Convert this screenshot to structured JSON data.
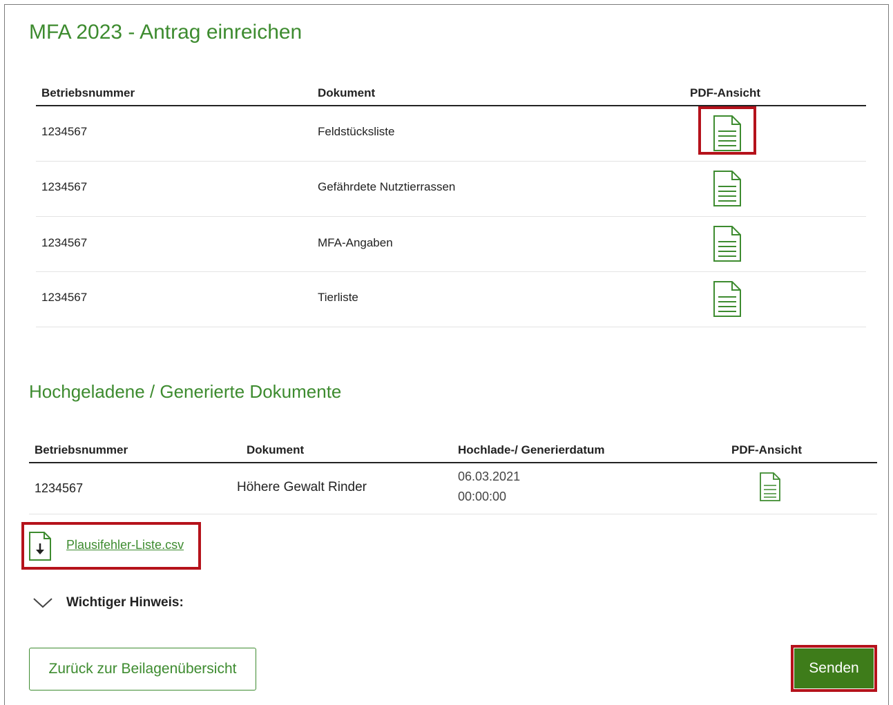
{
  "page": {
    "title": "MFA 2023 - Antrag einreichen"
  },
  "antrag_table": {
    "headers": [
      "Betriebsnummer",
      "Dokument",
      "PDF-Ansicht"
    ],
    "rows": [
      {
        "betriebsnummer": "1234567",
        "dokument": "Feldstücksliste",
        "icon": "pdf-document-icon"
      },
      {
        "betriebsnummer": "1234567",
        "dokument": "Gefährdete Nutztierrassen",
        "icon": "pdf-document-icon"
      },
      {
        "betriebsnummer": "1234567",
        "dokument": "MFA-Angaben",
        "icon": "pdf-document-icon"
      },
      {
        "betriebsnummer": "1234567",
        "dokument": "Tierliste",
        "icon": "pdf-document-icon"
      }
    ]
  },
  "uploads": {
    "title": "Hochgeladene / Generierte Dokumente",
    "headers": [
      "Betriebsnummer",
      "Dokument",
      "Hochlade-/ Generierdatum",
      "PDF-Ansicht"
    ],
    "rows": [
      {
        "betriebsnummer": "1234567",
        "dokument": "Höhere Gewalt Rinder",
        "datum": "06.03.2021",
        "zeit": "00:00:00",
        "icon": "pdf-document-icon"
      }
    ]
  },
  "csv_link": {
    "label": "Plausifehler-Liste.csv",
    "icon": "download-file-icon"
  },
  "hinweis": {
    "label": "Wichtiger Hinweis:",
    "icon": "chevron-down-icon"
  },
  "buttons": {
    "back": "Zurück zur Beilagenübersicht",
    "send": "Senden"
  },
  "colors": {
    "accent": "#3d8b2f",
    "send_button": "#3e7c1a",
    "highlight": "#b5121b"
  }
}
